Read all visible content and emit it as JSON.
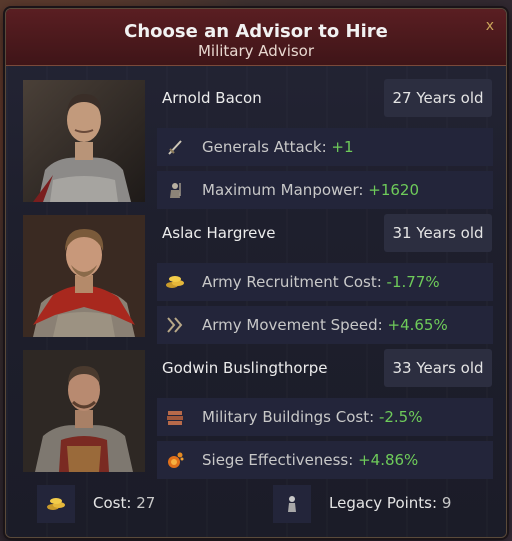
{
  "dialog": {
    "title": "Choose an Advisor to Hire",
    "subtitle": "Military Advisor",
    "close_label": "x"
  },
  "advisors": [
    {
      "name": "Arnold Bacon",
      "age": "27 Years old",
      "stats": [
        {
          "icon": "sword-icon",
          "label": "Generals Attack:",
          "value": "+1"
        },
        {
          "icon": "soldier-icon",
          "label": "Maximum Manpower:",
          "value": "+1620"
        }
      ]
    },
    {
      "name": "Aslac Hargreve",
      "age": "31 Years old",
      "stats": [
        {
          "icon": "gold-coins-icon",
          "label": "Army Recruitment Cost:",
          "value": "-1.77%"
        },
        {
          "icon": "double-chevron-icon",
          "label": "Army Movement Speed:",
          "value": "+4.65%"
        }
      ]
    },
    {
      "name": "Godwin Buslingthorpe",
      "age": "33 Years old",
      "stats": [
        {
          "icon": "bricks-icon",
          "label": "Military Buildings Cost:",
          "value": "-2.5%"
        },
        {
          "icon": "siege-fire-icon",
          "label": "Siege Effectiveness:",
          "value": "+4.86%"
        }
      ]
    }
  ],
  "footer": {
    "cost_label": "Cost:",
    "cost_value": "27",
    "legacy_label": "Legacy Points:",
    "legacy_value": "9"
  },
  "colors": {
    "title_bar": "#4a181c",
    "positive_value": "#6ecb5a",
    "row_background": "#23253a",
    "accent_gold": "#c9a45a"
  }
}
